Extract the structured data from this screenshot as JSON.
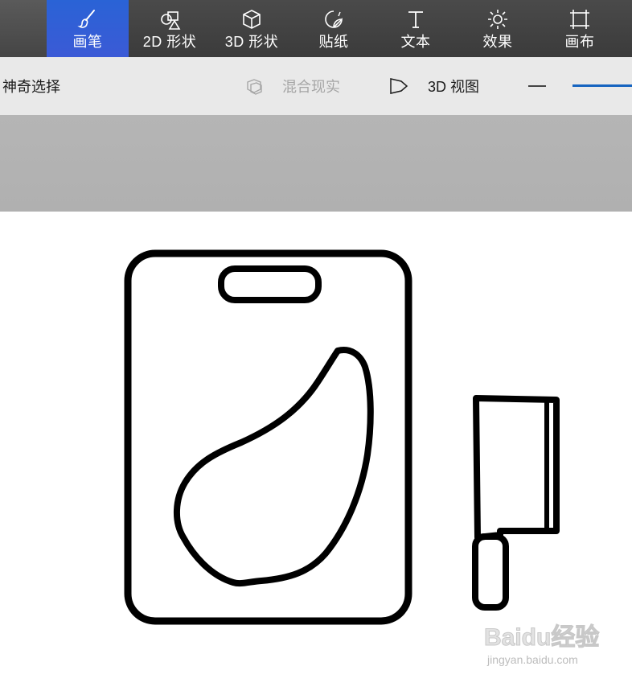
{
  "toolbar": {
    "tools": [
      {
        "label": "画笔",
        "icon": "brush-icon",
        "active": true
      },
      {
        "label": "2D 形状",
        "icon": "shapes-2d-icon",
        "active": false
      },
      {
        "label": "3D 形状",
        "icon": "cube-3d-icon",
        "active": false
      },
      {
        "label": "贴纸",
        "icon": "sticker-icon",
        "active": false
      },
      {
        "label": "文本",
        "icon": "text-icon",
        "active": false
      },
      {
        "label": "效果",
        "icon": "effects-sun-icon",
        "active": false
      },
      {
        "label": "画布",
        "icon": "canvas-crop-icon",
        "active": false
      }
    ]
  },
  "subtoolbar": {
    "magic_select": "神奇选择",
    "mixed_reality": "混合现实",
    "view_3d": "3D 视图"
  },
  "colors": {
    "active_tool_bg": "#2a63d6",
    "ribbon_bg": "#3b3b3b",
    "subbar_bg": "#e9e9e9",
    "zoom_accent": "#1664c0"
  },
  "watermark": {
    "brand": "Baidu经验",
    "url": "jingyan.baidu.com"
  }
}
